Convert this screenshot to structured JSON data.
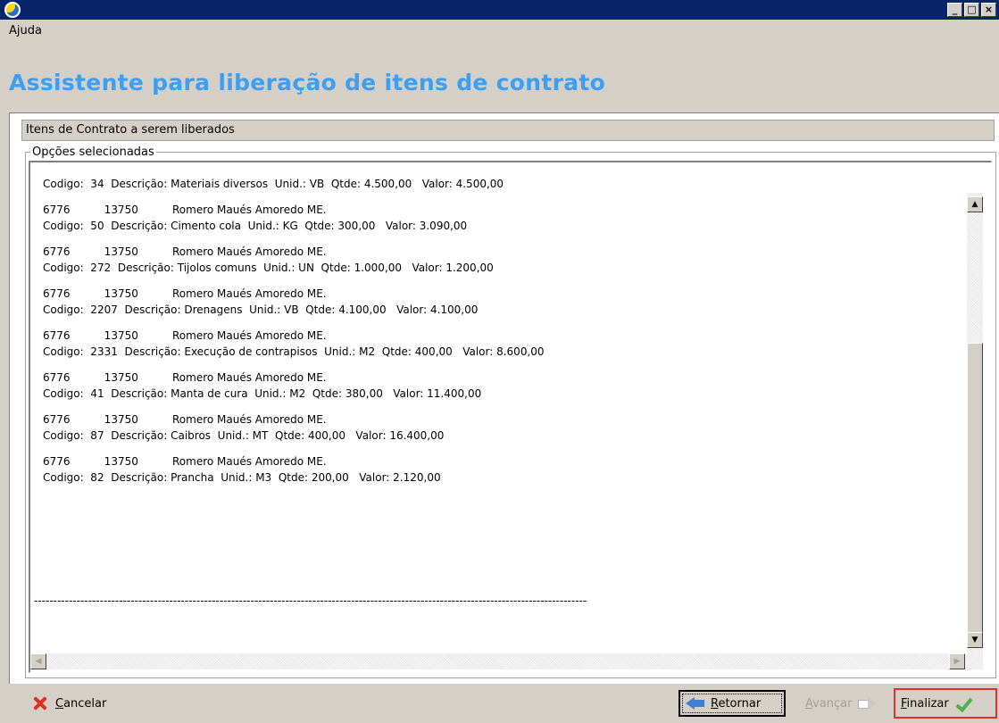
{
  "window": {
    "title": "",
    "controls": {
      "minimize": "_",
      "maximize": "□",
      "close": "×"
    }
  },
  "menu": {
    "items": [
      {
        "label": "Ajuda"
      }
    ]
  },
  "wizard": {
    "title": "Assistente para liberação de itens de contrato",
    "section_title": "Itens de Contrato a serem liberados",
    "group_label": "Opções selecionadas"
  },
  "memo": {
    "lines": [
      "Codigo:  34  Descrição: Materiais diversos  Unid.: VB  Qtde: 4.500,00   Valor: 4.500,00",
      "",
      "6776          13750          Romero Maués Amoredo ME.",
      "Codigo:  50  Descrição: Cimento cola  Unid.: KG  Qtde: 300,00   Valor: 3.090,00",
      "",
      "6776          13750          Romero Maués Amoredo ME.",
      "Codigo:  272  Descrição: Tijolos comuns  Unid.: UN  Qtde: 1.000,00   Valor: 1.200,00",
      "",
      "6776          13750          Romero Maués Amoredo ME.",
      "Codigo:  2207  Descrição: Drenagens  Unid.: VB  Qtde: 4.100,00   Valor: 4.100,00",
      "",
      "6776          13750          Romero Maués Amoredo ME.",
      "Codigo:  2331  Descrição: Execução de contrapisos  Unid.: M2  Qtde: 400,00   Valor: 8.600,00",
      "",
      "6776          13750          Romero Maués Amoredo ME.",
      "Codigo:  41  Descrição: Manta de cura  Unid.: M2  Qtde: 380,00   Valor: 11.400,00",
      "",
      "6776          13750          Romero Maués Amoredo ME.",
      "Codigo:  87  Descrição: Caibros  Unid.: MT  Qtde: 400,00   Valor: 16.400,00",
      "",
      "6776          13750          Romero Maués Amoredo ME.",
      "Codigo:  82  Descrição: Prancha  Unid.: M3  Qtde: 200,00   Valor: 2.120,00"
    ],
    "separator": "-------------------------------------------------------------------------------------------------------------------------------------------------------------------------------------------",
    "scroll_position": 0.33
  },
  "buttons": {
    "cancel": {
      "accel": "C",
      "rest": "ancelar"
    },
    "back": {
      "accel": "R",
      "rest": "etornar"
    },
    "next": {
      "accel": "A",
      "rest": "vançar"
    },
    "finish": {
      "accel": "F",
      "rest": "inalizar"
    }
  },
  "colors": {
    "title_bar": "#0a246a",
    "wizard_title": "#3d9ef2",
    "window_face": "#d4d0c8",
    "finish_highlight": "#e03030",
    "cancel_icon": "#e03020",
    "back_arrow": "#3f7fd6",
    "check": "#4caf50"
  },
  "icons": {
    "app": "app-icon",
    "cancel": "x-icon",
    "back": "arrow-left-icon",
    "next": "arrow-right-icon",
    "finish": "check-icon"
  }
}
